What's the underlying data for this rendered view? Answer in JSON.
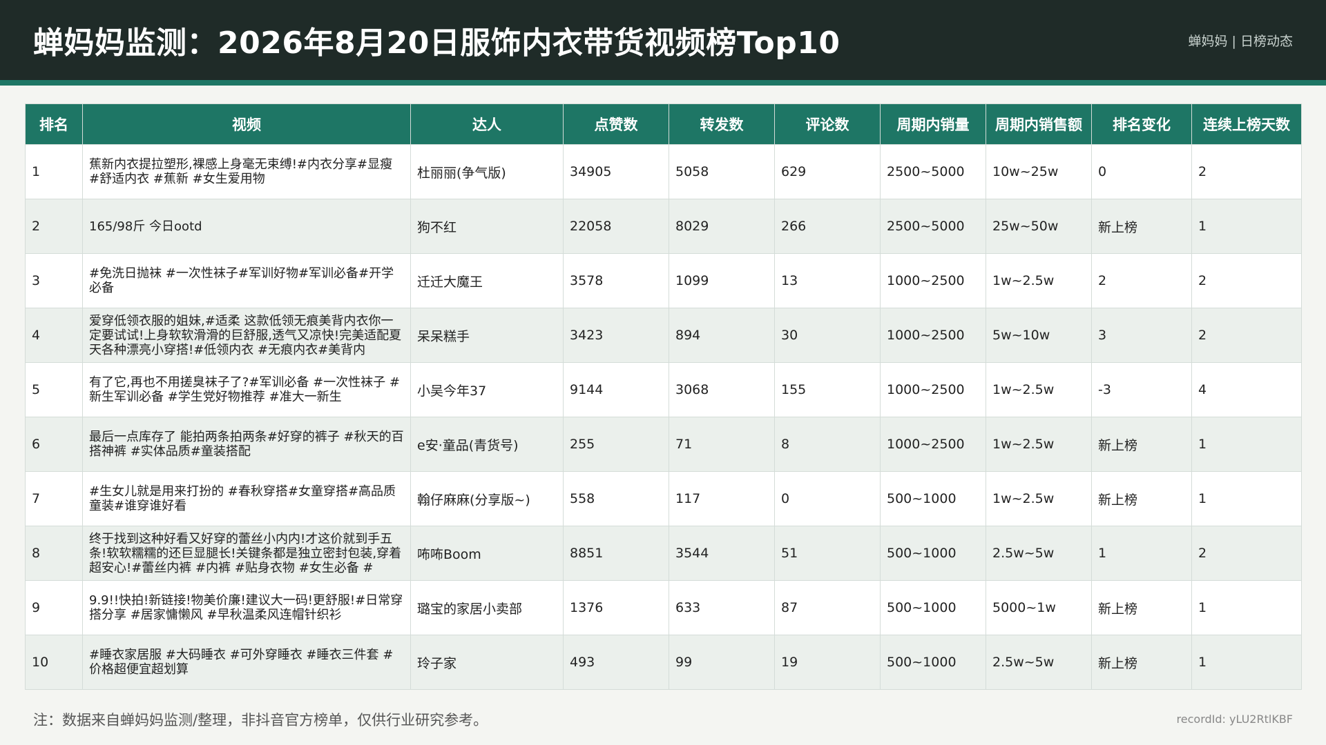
{
  "header": {
    "title": "蝉妈妈监测：2026年8月20日服饰内衣带货视频榜Top10",
    "brand": "蝉妈妈 | 日榜动态"
  },
  "table": {
    "columns": [
      "排名",
      "视频",
      "达人",
      "点赞数",
      "转发数",
      "评论数",
      "周期内销量",
      "周期内销售额",
      "排名变化",
      "连续上榜天数"
    ],
    "rows": [
      {
        "rank": "1",
        "video": "蕉新内衣提拉塑形,裸感上身毫无束缚!#内衣分享#显瘦 #舒适内衣 #蕉新 #女生爱用物",
        "creator": "杜丽丽(争气版)",
        "likes": "34905",
        "shares": "5058",
        "comments": "629",
        "sales": "2500~5000",
        "revenue": "10w~25w",
        "change": "0",
        "days": "2"
      },
      {
        "rank": "2",
        "video": "165/98斤 今日ootd",
        "creator": "狗不红",
        "likes": "22058",
        "shares": "8029",
        "comments": "266",
        "sales": "2500~5000",
        "revenue": "25w~50w",
        "change": "新上榜",
        "days": "1"
      },
      {
        "rank": "3",
        "video": "#免洗日抛袜 #一次性袜子#军训好物#军训必备#开学必备",
        "creator": "迁迁大魔王",
        "likes": "3578",
        "shares": "1099",
        "comments": "13",
        "sales": "1000~2500",
        "revenue": "1w~2.5w",
        "change": "2",
        "days": "2"
      },
      {
        "rank": "4",
        "video": "爱穿低领衣服的姐妹,#适柔 这款低领无痕美背内衣你一定要试试!上身软软滑滑的巨舒服,透气又凉快!完美适配夏天各种漂亮小穿搭!#低领内衣 #无痕内衣#美背内",
        "creator": "呆呆糕手",
        "likes": "3423",
        "shares": "894",
        "comments": "30",
        "sales": "1000~2500",
        "revenue": "5w~10w",
        "change": "3",
        "days": "2"
      },
      {
        "rank": "5",
        "video": "有了它,再也不用搓臭袜子了?#军训必备 #一次性袜子 #新生军训必备 #学生党好物推荐 #准大一新生",
        "creator": "小吴今年37",
        "likes": "9144",
        "shares": "3068",
        "comments": "155",
        "sales": "1000~2500",
        "revenue": "1w~2.5w",
        "change": "-3",
        "days": "4"
      },
      {
        "rank": "6",
        "video": "最后一点库存了 能拍两条拍两条#好穿的裤子 #秋天的百搭神裤 #实体品质#童装搭配",
        "creator": "e安·童品(青货号)",
        "likes": "255",
        "shares": "71",
        "comments": "8",
        "sales": "1000~2500",
        "revenue": "1w~2.5w",
        "change": "新上榜",
        "days": "1"
      },
      {
        "rank": "7",
        "video": "#生女儿就是用来打扮的 #春秋穿搭#女童穿搭#高品质童装#谁穿谁好看",
        "creator": "翰仔麻麻(分享版~)",
        "likes": "558",
        "shares": "117",
        "comments": "0",
        "sales": "500~1000",
        "revenue": "1w~2.5w",
        "change": "新上榜",
        "days": "1"
      },
      {
        "rank": "8",
        "video": "终于找到这种好看又好穿的蕾丝小内内!才这价就到手五条!软软糯糯的还巨显腿长!关键条都是独立密封包装,穿着超安心!#蕾丝内裤 #内裤 #贴身衣物 #女生必备 #",
        "creator": "咘咘Boom",
        "likes": "8851",
        "shares": "3544",
        "comments": "51",
        "sales": "500~1000",
        "revenue": "2.5w~5w",
        "change": "1",
        "days": "2"
      },
      {
        "rank": "9",
        "video": "9.9!!快拍!新链接!物美价廉!建议大一码!更舒服!#日常穿搭分享 #居家慵懒风 #早秋温柔风连帽针织衫",
        "creator": "璐宝的家居小卖部",
        "likes": "1376",
        "shares": "633",
        "comments": "87",
        "sales": "500~1000",
        "revenue": "5000~1w",
        "change": "新上榜",
        "days": "1"
      },
      {
        "rank": "10",
        "video": "#睡衣家居服 #大码睡衣 #可外穿睡衣 #睡衣三件套 #价格超便宜超划算",
        "creator": "玲子家",
        "likes": "493",
        "shares": "99",
        "comments": "19",
        "sales": "500~1000",
        "revenue": "2.5w~5w",
        "change": "新上榜",
        "days": "1"
      }
    ]
  },
  "footer": {
    "note": "注：数据来自蝉妈妈监测/整理，非抖音官方榜单，仅供行业研究参考。",
    "record_id": "recordId: yLU2RtlKBF"
  }
}
